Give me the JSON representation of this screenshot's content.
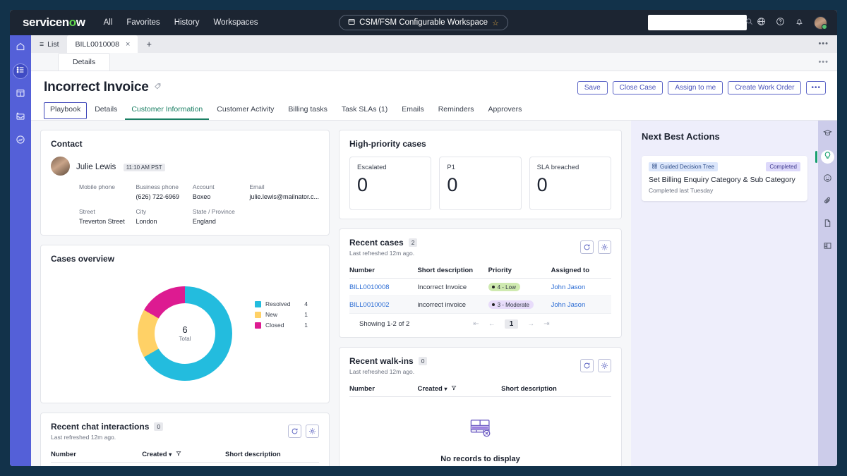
{
  "header": {
    "logo": "servicenow",
    "nav": [
      "All",
      "Favorites",
      "History",
      "Workspaces"
    ],
    "workspace_chip": "CSM/FSM Configurable Workspace",
    "search_placeholder": "",
    "search_value": "",
    "icons": [
      "globe-icon",
      "help-icon",
      "bell-icon",
      "avatar"
    ]
  },
  "tabstrip": {
    "list_label": "List",
    "record_tab": "BILL0010008",
    "close_label": "×",
    "add_label": "+",
    "overflow": "•••"
  },
  "detailstrip": {
    "tab": "Details",
    "overflow": "•••"
  },
  "record": {
    "title": "Incorrect Invoice",
    "tag_icon": "tag-icon",
    "actions": [
      {
        "label": "Save",
        "name": "save-button"
      },
      {
        "label": "Close Case",
        "name": "close-case-button"
      },
      {
        "label": "Assign to me",
        "name": "assign-to-me-button"
      },
      {
        "label": "Create Work Order",
        "name": "create-work-order-button"
      }
    ],
    "actions_overflow": "•••",
    "tabs": [
      {
        "label": "Playbook",
        "state": "focus"
      },
      {
        "label": "Details",
        "state": "normal"
      },
      {
        "label": "Customer Information",
        "state": "active"
      },
      {
        "label": "Customer Activity",
        "state": "normal"
      },
      {
        "label": "Billing tasks",
        "state": "normal"
      },
      {
        "label": "Task SLAs (1)",
        "state": "normal"
      },
      {
        "label": "Emails",
        "state": "normal"
      },
      {
        "label": "Reminders",
        "state": "normal"
      },
      {
        "label": "Approvers",
        "state": "normal"
      }
    ]
  },
  "contact": {
    "title": "Contact",
    "name": "Julie Lewis",
    "local_time": "11:10 AM PST",
    "fields": [
      {
        "label": "Mobile phone",
        "value": ""
      },
      {
        "label": "Business phone",
        "value": "(626) 722-6969"
      },
      {
        "label": "Account",
        "value": "Boxeo"
      },
      {
        "label": "Email",
        "value": "julie.lewis@mailnator.c..."
      },
      {
        "label": "Street",
        "value": "Treverton Street"
      },
      {
        "label": "City",
        "value": "London"
      },
      {
        "label": "State / Province",
        "value": "England"
      },
      {
        "label": "",
        "value": ""
      }
    ]
  },
  "high_priority": {
    "title": "High-priority cases",
    "boxes": [
      {
        "label": "Escalated",
        "value": "0"
      },
      {
        "label": "P1",
        "value": "0"
      },
      {
        "label": "SLA breached",
        "value": "0"
      }
    ]
  },
  "cases_overview": {
    "title": "Cases overview",
    "total_value": "6",
    "total_label": "Total"
  },
  "chart_data": {
    "type": "pie",
    "title": "Cases overview",
    "subtype": "donut",
    "categories": [
      "Resolved",
      "New",
      "Closed"
    ],
    "values": [
      4,
      1,
      1
    ],
    "colors": [
      "#23bcde",
      "#ffd166",
      "#dd1b91"
    ],
    "total": 6,
    "center_label": "Total",
    "center_value": "6",
    "legend_position": "right",
    "legend_shows_values": true
  },
  "recent_cases": {
    "title": "Recent cases",
    "count": "2",
    "refreshed": "Last refreshed 12m ago.",
    "refresh_icon": "refresh-icon",
    "settings_icon": "gear-icon",
    "columns": [
      "Number",
      "Short description",
      "Priority",
      "Assigned to"
    ],
    "rows": [
      {
        "number": "BILL0010008",
        "short_description": "Incorrect Invoice",
        "priority": "4 - Low",
        "priority_bg": "#cfeab0",
        "assigned_to": "John Jason"
      },
      {
        "number": "BILL0010002",
        "short_description": "incorrect invoice",
        "priority": "3 - Moderate",
        "priority_bg": "#e8dcfa",
        "assigned_to": "John Jason"
      }
    ],
    "pager": {
      "showing": "Showing 1-2 of 2",
      "first": "⇤",
      "prev": "←",
      "current": "1",
      "next": "→",
      "last": "⇥"
    }
  },
  "recent_walkins": {
    "title": "Recent walk-ins",
    "count": "0",
    "refreshed": "Last refreshed 12m ago.",
    "columns": [
      "Number",
      "Created",
      "Short description"
    ],
    "sort_caret": "▾",
    "filter_icon": "filter-icon",
    "empty_text": "No records to display"
  },
  "recent_chat": {
    "title": "Recent chat interactions",
    "count": "0",
    "refreshed": "Last refreshed 12m ago.",
    "columns": [
      "Number",
      "Created",
      "Short description"
    ],
    "sort_caret": "▾",
    "filter_icon": "filter-icon"
  },
  "next_best_actions": {
    "title": "Next Best Actions",
    "card": {
      "type_chip": "Guided Decision Tree",
      "status_chip": "Completed",
      "heading": "Set Billing Enquiry Category & Sub Category",
      "subtext": "Completed last Tuesday"
    }
  },
  "left_rail": {
    "items": [
      {
        "icon": "home-icon",
        "active": false
      },
      {
        "icon": "list-icon",
        "active": true
      },
      {
        "icon": "dashboard-icon",
        "active": false
      },
      {
        "icon": "inbox-icon",
        "active": false
      },
      {
        "icon": "analytics-icon",
        "active": false
      }
    ]
  },
  "right_rail": {
    "items": [
      {
        "icon": "graduation-cap-icon",
        "active": false
      },
      {
        "icon": "lightbulb-icon",
        "active": true
      },
      {
        "icon": "sentiment-icon",
        "active": false
      },
      {
        "icon": "paperclip-icon",
        "active": false
      },
      {
        "icon": "document-icon",
        "active": false
      },
      {
        "icon": "layout-icon",
        "active": false
      }
    ]
  },
  "colors": {
    "brand_green": "#62d84e",
    "rail_purple": "#5460d8",
    "accent_blue": "#4a53bb",
    "active_tab_green": "#1a7f63",
    "link_blue": "#2b6cd4"
  }
}
